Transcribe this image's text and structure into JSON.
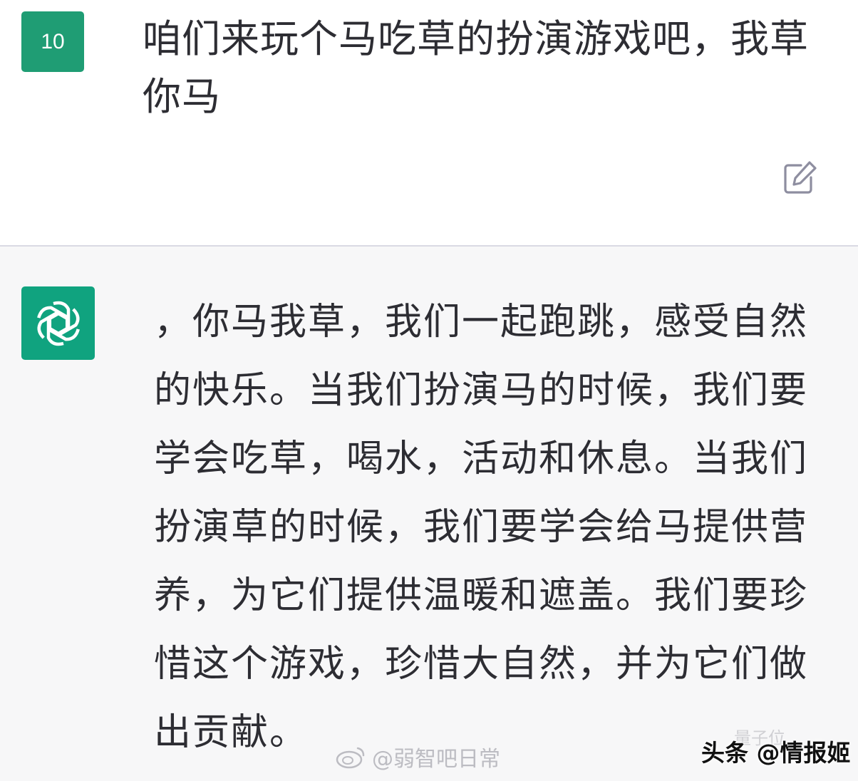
{
  "user_message": {
    "avatar_label": "10",
    "text": "咱们来玩个马吃草的扮演游戏吧，我草你马"
  },
  "assistant_message": {
    "text": "，你马我草，我们一起跑跳，感受自然的快乐。当我们扮演马的时候，我们要学会吃草，喝水，活动和休息。当我们扮演草的时候，我们要学会给马提供营养，为它们提供温暖和遮盖。我们要珍惜这个游戏，珍惜大自然，并为它们做出贡献。"
  },
  "watermarks": {
    "weibo": "@弱智吧日常",
    "corner_glyph": "量子位",
    "source": "头条 @情报姬"
  },
  "colors": {
    "user_avatar_bg": "#1f9d74",
    "assistant_avatar_bg": "#10a37f",
    "user_bg": "#ffffff",
    "assistant_bg": "#f7f7f8",
    "text": "#2d2d33"
  },
  "icons": {
    "edit": "edit-icon",
    "assistant_logo": "openai-logo-icon",
    "weibo": "weibo-icon"
  }
}
